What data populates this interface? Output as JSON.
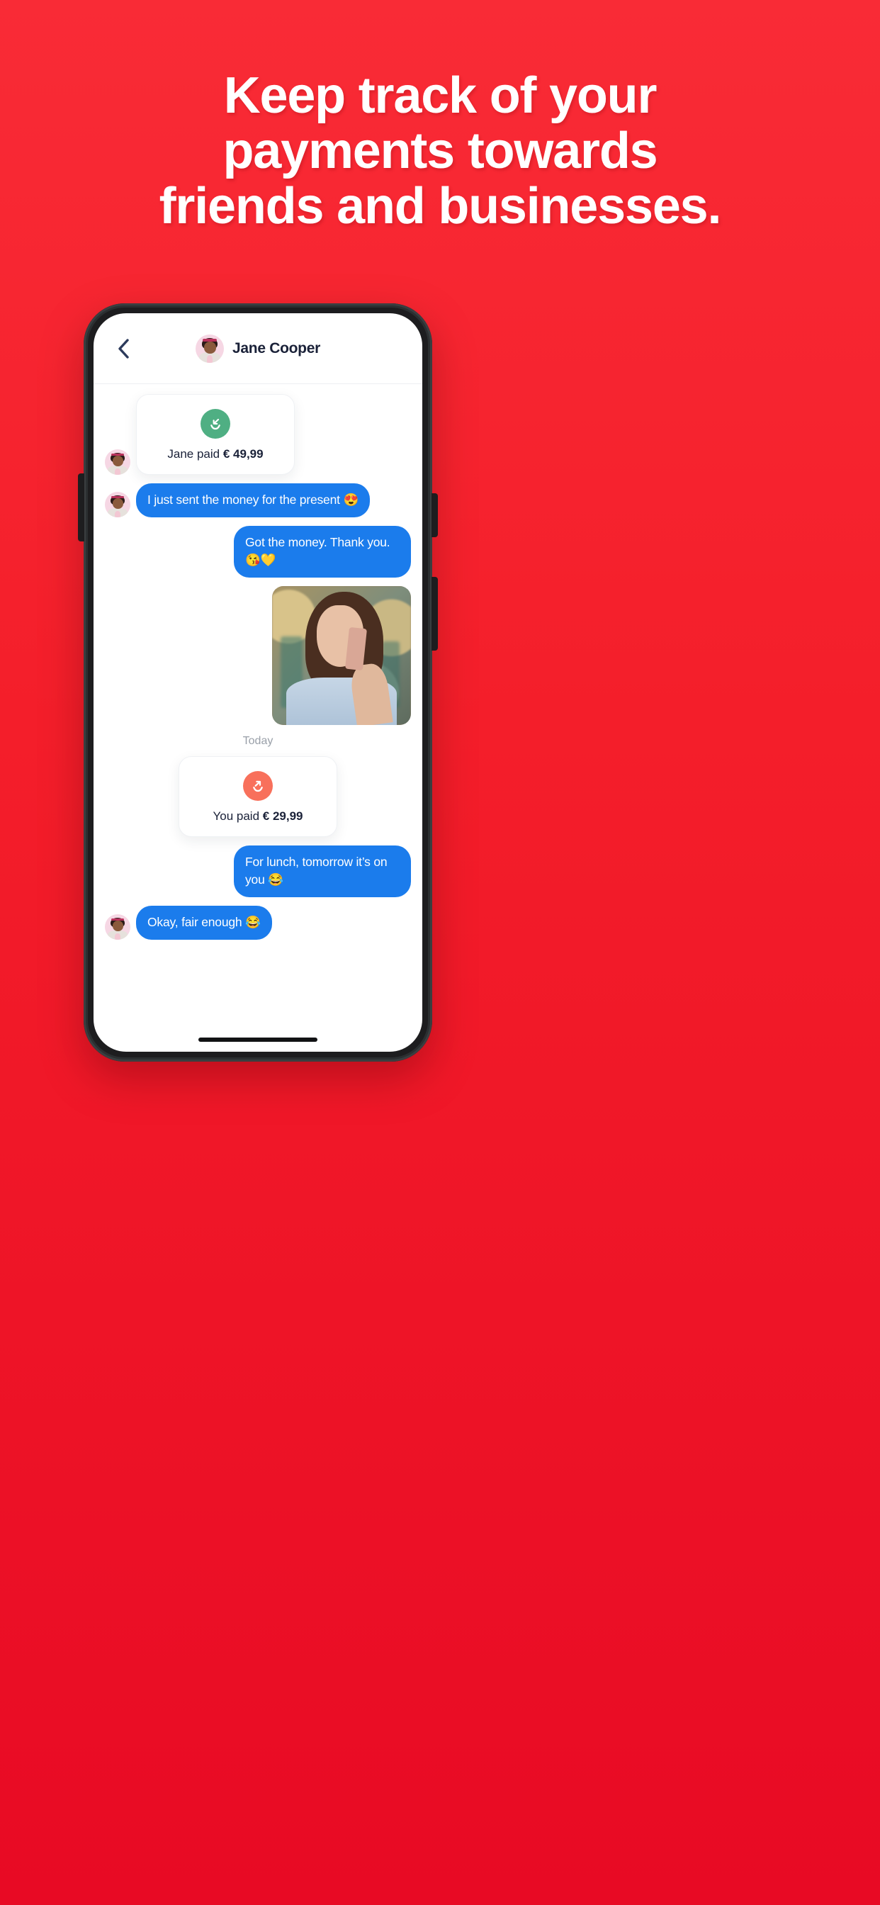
{
  "hero": {
    "headline_lines": [
      "Keep track of your",
      "payments towards",
      "friends and businesses."
    ],
    "background_color": "#F41E2A",
    "text_color": "#FFFFFF"
  },
  "phone": {
    "frame_color": "#1D1D1F",
    "screen_background": "#FFFFFF"
  },
  "chat": {
    "header": {
      "back_icon": "chevron-left-icon",
      "avatar_icon": "contact-avatar",
      "contact_name": "Jane Cooper"
    },
    "day_divider": "Today",
    "accent_colors": {
      "bubble_blue": "#1B7CEC",
      "received_payment_green": "#4FAF83",
      "sent_payment_orange": "#F8705B",
      "name_navy": "#1A2138",
      "divider_gray": "#9AA0A9"
    },
    "messages": [
      {
        "type": "payment",
        "direction": "received",
        "icon": "arrow-down-left-smile-icon",
        "icon_color": "#4FAF83",
        "label": "Jane paid",
        "amount": "€ 49,99"
      },
      {
        "type": "text",
        "direction": "in",
        "text": "I just sent the money for the present 😍"
      },
      {
        "type": "text",
        "direction": "out",
        "text": "Got the money. Thank you. 😘💛"
      },
      {
        "type": "image",
        "direction": "out",
        "alt": "woman-on-phone-photo"
      },
      {
        "type": "payment",
        "direction": "sent",
        "icon": "arrow-up-right-smile-icon",
        "icon_color": "#F8705B",
        "label": "You paid",
        "amount": "€ 29,99"
      },
      {
        "type": "text",
        "direction": "out",
        "text": "For lunch, tomorrow it’s on you 😂"
      },
      {
        "type": "text",
        "direction": "in",
        "text": "Okay, fair enough 😂"
      }
    ]
  }
}
